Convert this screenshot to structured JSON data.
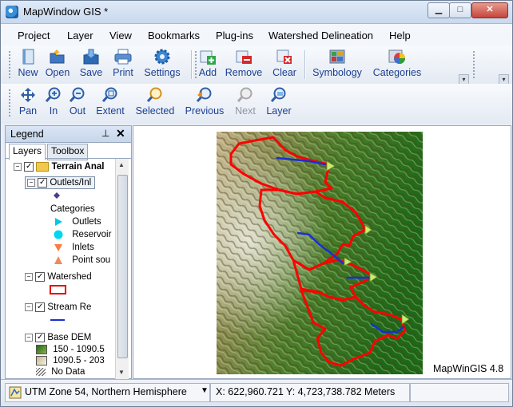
{
  "window": {
    "title": "MapWindow GIS *",
    "minimize_glyph": "▁",
    "maximize_glyph": "□",
    "close_glyph": "✕"
  },
  "menu": [
    "Project",
    "Layer",
    "View",
    "Bookmarks",
    "Plug-ins",
    "Watershed Delineation",
    "Help"
  ],
  "toolbar1": {
    "new": "New",
    "open": "Open",
    "save": "Save",
    "print": "Print",
    "settings": "Settings",
    "add": "Add",
    "remove": "Remove",
    "clear": "Clear",
    "symbology": "Symbology",
    "categories": "Categories"
  },
  "toolbar2": {
    "pan": "Pan",
    "zoom_in": "In",
    "zoom_out": "Out",
    "extent": "Extent",
    "selected": "Selected",
    "previous": "Previous",
    "next": "Next",
    "layer": "Layer"
  },
  "legend": {
    "title": "Legend",
    "pin_glyph": "⊥",
    "close_glyph": "✕",
    "tabs": {
      "layers": "Layers",
      "toolbox": "Toolbox"
    },
    "group": "Terrain Anal",
    "outlets_layer": "Outlets/Inl",
    "categories_label": "Categories",
    "categories": [
      "Outlets",
      "Reservoir",
      "Inlets",
      "Point sou"
    ],
    "watershed_layer": "Watershed",
    "stream_layer": "Stream Re",
    "dem_layer": "Base DEM",
    "dem_classes": [
      "150 - 1090.5",
      "1090.5 - 203",
      "No Data"
    ]
  },
  "map": {
    "caption": "MapWinGIS 4.8"
  },
  "status": {
    "projection": "UTM Zone 54, Northern Hemisphere",
    "coordinates": "X: 622,960.721 Y: 4,723,738.782 Meters"
  },
  "colors": {
    "accent_text": "#1b3f91",
    "watershed_outline": "#ff0000",
    "stream": "#1a2fd0",
    "outlet_marker": "#c8ee70",
    "category_outlets": "#00c8e6",
    "category_reservoir": "#00d6f0",
    "category_inlets": "#ff7a3c",
    "category_point_source": "#f08a5a",
    "dem_low": "#1f6a14",
    "dem_high": "#f2f2ea"
  }
}
